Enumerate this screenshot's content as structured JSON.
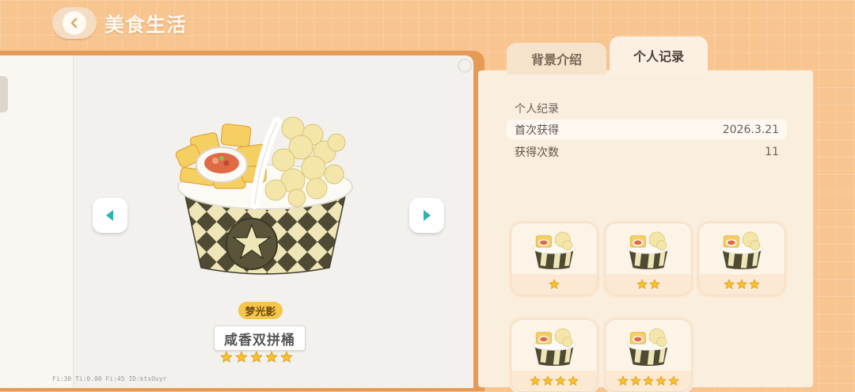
{
  "header": {
    "title": "美食生活"
  },
  "tabs": [
    {
      "label": "背景介绍",
      "active": false
    },
    {
      "label": "个人记录",
      "active": true
    }
  ],
  "food": {
    "rarity": "梦光影",
    "name": "咸香双拼桶",
    "stars": 5
  },
  "record": {
    "title": "个人纪录",
    "rows": [
      {
        "label": "首次获得",
        "value": "2026.3.21"
      },
      {
        "label": "获得次数",
        "value": "11"
      }
    ]
  },
  "variants": [
    {
      "stars": 1
    },
    {
      "stars": 2
    },
    {
      "stars": 3
    },
    {
      "stars": 4
    },
    {
      "stars": 5
    }
  ],
  "debug": "Fi:30  Ti:0.00  Fi:45  ID:ktsOvyr",
  "colors": {
    "star": "#f8c12e",
    "nav_arrow": "#2bb5ad",
    "badge": "#f6c64a",
    "background": "#f8c48f"
  }
}
